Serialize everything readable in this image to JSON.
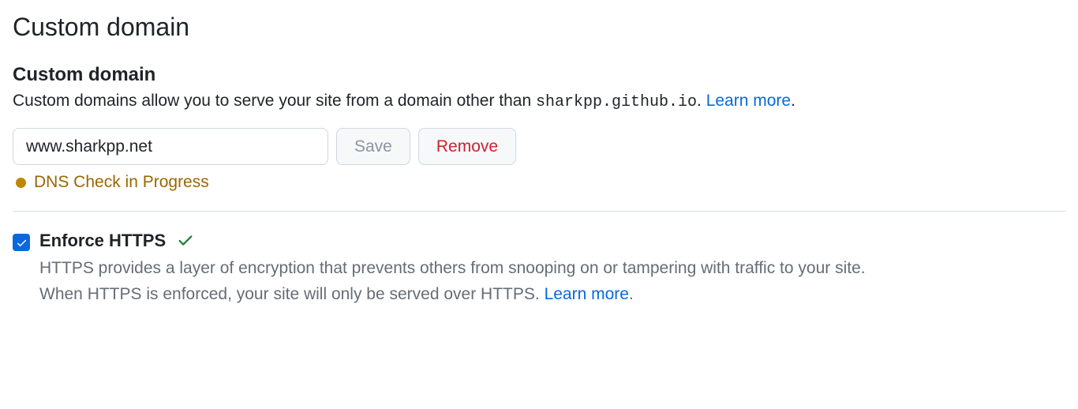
{
  "section": {
    "title": "Custom domain",
    "subheading": "Custom domain",
    "desc_prefix": "Custom domains allow you to serve your site from a domain other than ",
    "default_domain": "sharkpp.github.io",
    "desc_suffix": ". ",
    "learn_more": "Learn more",
    "punct": "."
  },
  "form": {
    "domain_value": "www.sharkpp.net",
    "save_label": "Save",
    "remove_label": "Remove"
  },
  "status": {
    "text": "DNS Check in Progress",
    "color": "#bf8700"
  },
  "enforce": {
    "label": "Enforce HTTPS",
    "checked": true,
    "desc_line1": "HTTPS provides a layer of encryption that prevents others from snooping on or tampering with traffic to your site.",
    "desc_line2_prefix": "When HTTPS is enforced, your site will only be served over HTTPS. ",
    "learn_more": "Learn more",
    "punct": "."
  }
}
